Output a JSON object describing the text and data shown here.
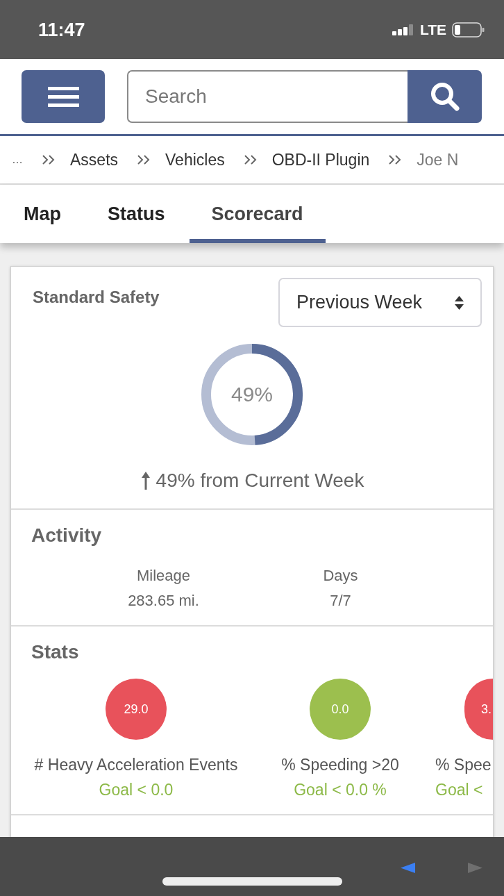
{
  "status_bar": {
    "time": "11:47",
    "network": "LTE"
  },
  "header": {
    "search": {
      "placeholder": "Search"
    }
  },
  "breadcrumb": [
    {
      "label": "…",
      "kind": "more"
    },
    {
      "label": "Assets",
      "kind": "link"
    },
    {
      "label": "Vehicles",
      "kind": "link"
    },
    {
      "label": "OBD-II Plugin",
      "kind": "link"
    },
    {
      "label": "Joe N",
      "kind": "current"
    }
  ],
  "tabs": [
    {
      "label": "Map",
      "selected": false
    },
    {
      "label": "Status",
      "selected": false
    },
    {
      "label": "Scorecard",
      "selected": true
    }
  ],
  "scorecard": {
    "title": "Standard Safety",
    "period": "Previous Week",
    "score": {
      "level": 0.49,
      "reading": "49%"
    },
    "trend": {
      "rising": true,
      "text": "49% from Current Week"
    }
  },
  "activity": {
    "title": "Activity",
    "metrics": [
      {
        "label": "Mileage",
        "value": "283.65 mi."
      },
      {
        "label": "Days",
        "value": "7/7"
      }
    ]
  },
  "stats": {
    "title": "Stats",
    "items": [
      {
        "value": "29.0",
        "label": "# Heavy Acceleration Events",
        "goal": "Goal < 0.0",
        "color": "#e8525b"
      },
      {
        "value": "0.0",
        "label": "% Speeding >20",
        "goal": "Goal < 0.0 %",
        "color": "#9cbf4e"
      },
      {
        "value": "3.",
        "label": "% Spee",
        "goal": "Goal <",
        "color": "#e8525b"
      }
    ]
  },
  "browser_nav": {
    "back": {
      "disabled": false
    },
    "forward": {
      "disabled": true
    }
  }
}
